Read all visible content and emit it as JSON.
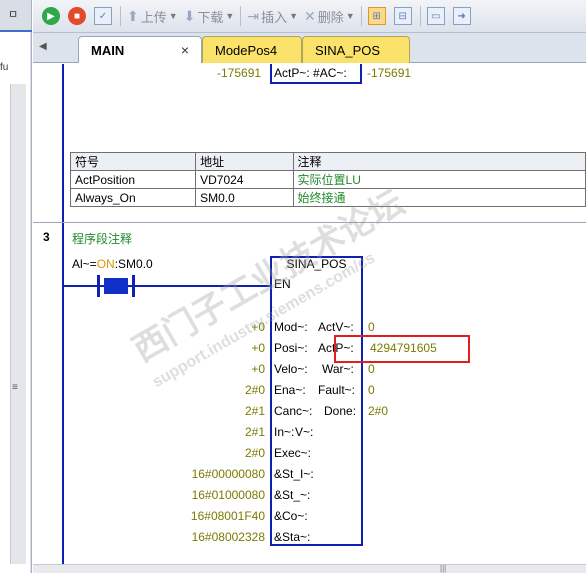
{
  "toolbar": {
    "upload_label": "上传",
    "download_label": "下载",
    "insert_label": "插入",
    "delete_label": "删除"
  },
  "tabs": [
    {
      "label": "MAIN",
      "active": true,
      "close": "×"
    },
    {
      "label": "ModePos4",
      "active": false
    },
    {
      "label": "SINA_POS",
      "active": false
    }
  ],
  "left_panel": {
    "pin": "ㅁ",
    "label": "fu",
    "grip": "≡"
  },
  "network2": {
    "left_value": "-175691",
    "pin_label": "ActP~: #AC~:",
    "right_value": "-175691",
    "symbol_table": {
      "headers": [
        "符号",
        "地址",
        "注释"
      ],
      "rows": [
        [
          "ActPosition",
          "VD7024",
          "实际位置LU"
        ],
        [
          "Always_On",
          "SM0.0",
          "始终接通"
        ]
      ]
    }
  },
  "network3": {
    "number": "3",
    "comment": "程序段注释",
    "contact": {
      "prefix": "Al~=",
      "state": "ON",
      "suffix": ":SM0.0"
    },
    "block": {
      "title": "SINA_POS",
      "en_label": "EN",
      "inputs": [
        {
          "value": "+0",
          "pin": "Mod~:"
        },
        {
          "value": "+0",
          "pin": "Posi~:"
        },
        {
          "value": "+0",
          "pin": "Velo~:"
        },
        {
          "value": "2#0",
          "pin": "Ena~:"
        },
        {
          "value": "2#1",
          "pin": "Canc~:"
        },
        {
          "value": "2#1",
          "pin": "In~:"
        },
        {
          "value": "2#0",
          "pin": "Exec~:"
        },
        {
          "value": "16#00000080",
          "pin": "&St_I~:"
        },
        {
          "value": "16#01000080",
          "pin": "&St_~:"
        },
        {
          "value": "16#08001F40",
          "pin": "&Co~:"
        },
        {
          "value": "16#08002328",
          "pin": "&Sta~:"
        }
      ],
      "outputs": [
        {
          "pin": "ActV~:",
          "value": "0"
        },
        {
          "pin": "ActP~:",
          "value": "4294791605"
        },
        {
          "pin": "War~:",
          "value": "0"
        },
        {
          "pin": "Fault~:",
          "value": "0"
        },
        {
          "pin": "Done:",
          "value": "2#0"
        },
        {
          "pin": "V~:",
          "value": ""
        }
      ]
    }
  },
  "watermark": {
    "line1": "西门子工业技术论坛",
    "line2": "support.industry.siemens.com/cs"
  },
  "colors": {
    "ladder_blue": "#1020b0",
    "value_olive": "#7d7a00",
    "comment_green": "#1f8a2a",
    "highlight_red": "#e02020",
    "tab_yellow": "#fbe36b"
  }
}
